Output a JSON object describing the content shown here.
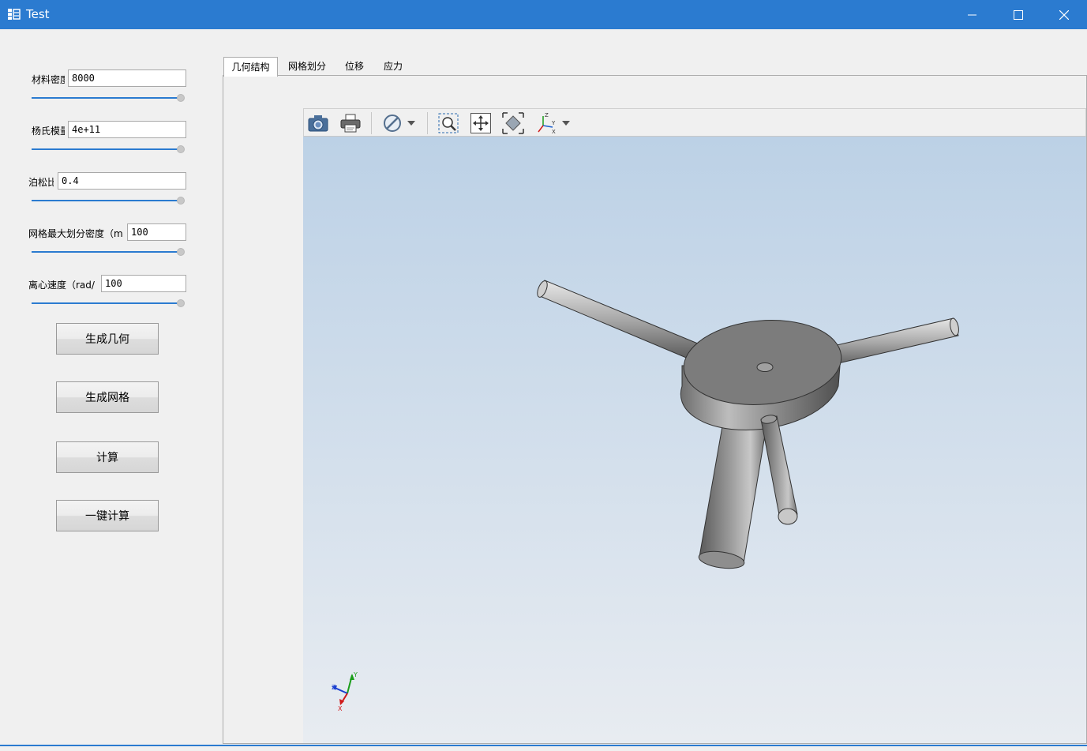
{
  "window": {
    "title": "Test"
  },
  "params": [
    {
      "label": "材料密度",
      "value": "8000",
      "slider_level": 1.0
    },
    {
      "label": "杨氏模量",
      "value": "4e+11",
      "slider_level": 1.0
    },
    {
      "label": "泊松比",
      "value": "0.4",
      "slider_level": 1.0
    },
    {
      "label": "网格最大划分密度（m",
      "value": "100",
      "slider_level": 1.0
    },
    {
      "label": "离心速度（rad/",
      "value": "100",
      "slider_level": 1.0
    }
  ],
  "buttons": {
    "gen_geometry": "生成几何",
    "gen_mesh": "生成网格",
    "compute": "计算",
    "one_click": "一键计算"
  },
  "tabs": [
    "几何结构",
    "网格划分",
    "位移",
    "应力"
  ],
  "active_tab": 0,
  "toolbar": {
    "icons": [
      "camera-icon",
      "printer-icon",
      "hide-icon",
      "zoom-box-icon",
      "pan-icon",
      "fit-all-icon",
      "axes-view-icon"
    ]
  },
  "axes_triad": {
    "x": "X",
    "y": "Y",
    "z": "Z"
  },
  "colors": {
    "titlebar": "#2b7bd0",
    "accent": "#2b7bd0",
    "viewport_top": "#bcd1e6",
    "viewport_bottom": "#e8ecf1"
  }
}
